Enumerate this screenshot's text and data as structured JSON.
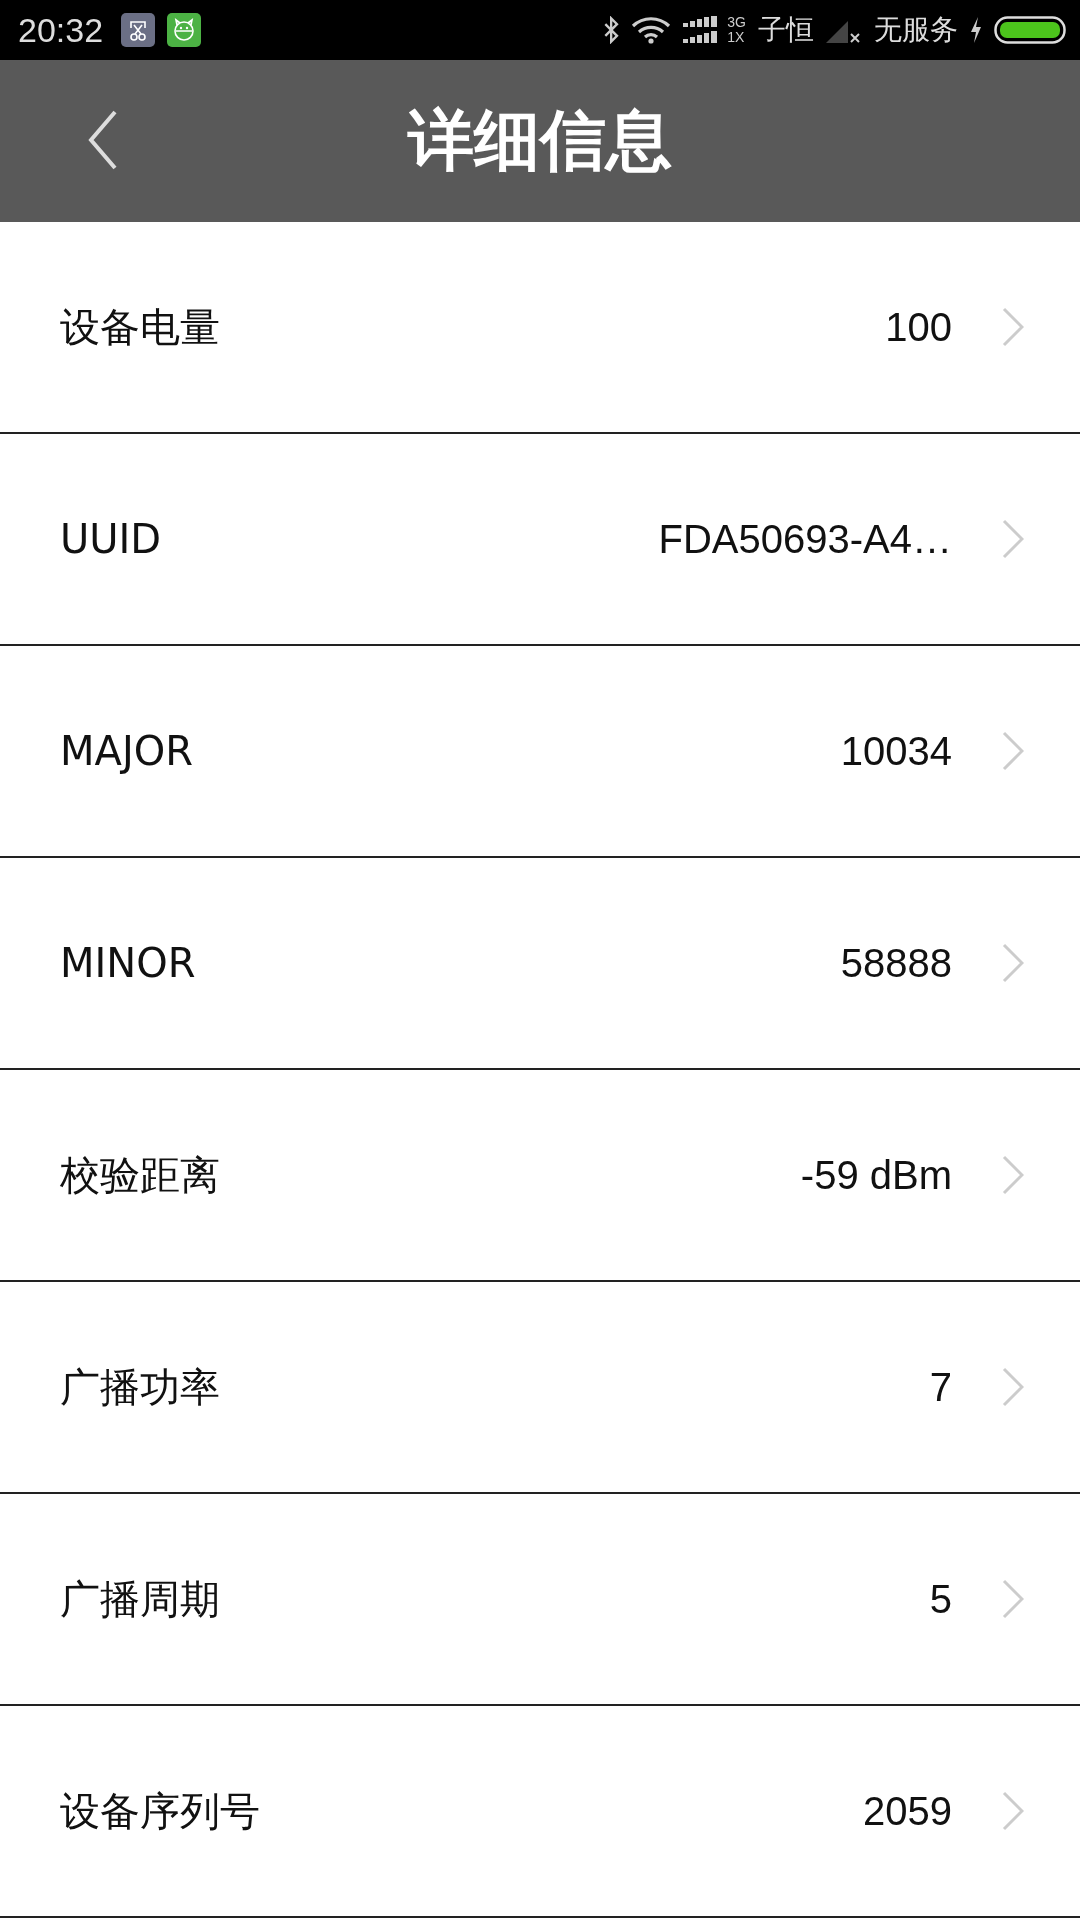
{
  "status_bar": {
    "time": "20:32",
    "network_type_top": "3G",
    "network_type_bottom": "1X",
    "carrier_1": "子恒",
    "carrier_2": "无服务"
  },
  "header": {
    "title": "详细信息"
  },
  "rows": [
    {
      "label": "设备电量",
      "value": "100"
    },
    {
      "label": "UUID",
      "value": "FDA50693-A4…"
    },
    {
      "label": "MAJOR",
      "value": "10034"
    },
    {
      "label": "MINOR",
      "value": "58888"
    },
    {
      "label": "校验距离",
      "value": "-59 dBm"
    },
    {
      "label": "广播功率",
      "value": "7"
    },
    {
      "label": "广播周期",
      "value": "5"
    },
    {
      "label": "设备序列号",
      "value": "2059"
    }
  ]
}
